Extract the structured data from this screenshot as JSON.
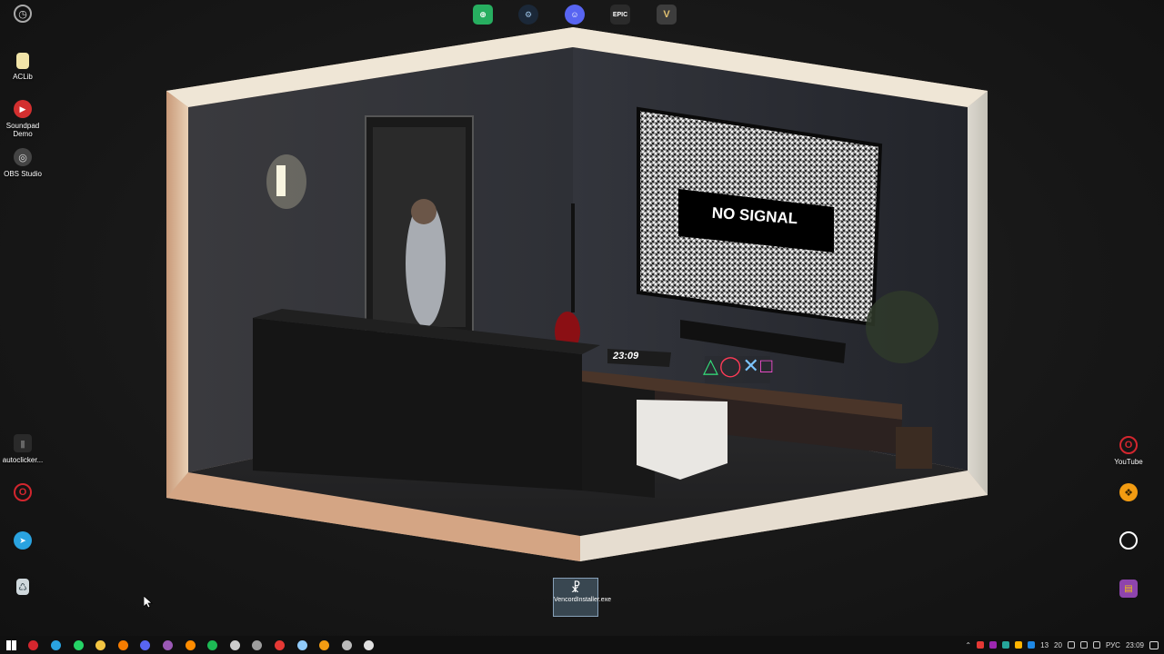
{
  "desktop": {
    "left_icons": [
      {
        "name": "clock-app-icon",
        "label": "",
        "color": "#9aa0a6",
        "glyph": "◷"
      },
      {
        "name": "aclib-icon",
        "label": "ACLib",
        "color": "#f1e4a8",
        "glyph": ""
      },
      {
        "name": "soundpad-icon",
        "label": "Soundpad Demo",
        "color": "#d32f2f",
        "glyph": "▶"
      },
      {
        "name": "obs-studio-icon",
        "label": "OBS Studio",
        "color": "#555555",
        "glyph": "◎"
      }
    ],
    "left_lower_icons": [
      {
        "name": "autoclicker-icon",
        "label": "autoclicker...",
        "color": "#333333",
        "glyph": "▮"
      },
      {
        "name": "opera-icon",
        "label": "",
        "color": "#d3262e",
        "glyph": "O"
      },
      {
        "name": "telegram-icon",
        "label": "",
        "color": "#2aa3e0",
        "glyph": "➤"
      },
      {
        "name": "recycle-bin-icon",
        "label": "",
        "color": "#b0bec5",
        "glyph": "♺"
      }
    ],
    "right_icons": [
      {
        "name": "youtube-opera-icon",
        "label": "YouTube",
        "color": "#d3262e",
        "glyph": "O"
      },
      {
        "name": "fl-studio-icon",
        "label": "",
        "color": "#f39c12",
        "glyph": "❖"
      },
      {
        "name": "chat-app-icon",
        "label": "",
        "color": "#ffffff",
        "glyph": "◯"
      },
      {
        "name": "winrar-icon",
        "label": "",
        "color": "#8e44ad",
        "glyph": "▤"
      }
    ],
    "top_icons": [
      {
        "name": "xbox-app-icon",
        "label": "",
        "color": "#27ae60",
        "glyph": "⊕"
      },
      {
        "name": "steam-icon",
        "label": "",
        "color": "#1b2838",
        "glyph": "⚙"
      },
      {
        "name": "discord-icon",
        "label": "",
        "color": "#5865f2",
        "glyph": "☺"
      },
      {
        "name": "epic-games-icon",
        "label": "EPIC",
        "color": "#2b2b2b",
        "glyph": ""
      },
      {
        "name": "gta-icon",
        "label": "V",
        "color": "#3d3d3d",
        "glyph": ""
      }
    ],
    "vencord": {
      "label": "VencordInstaller.exe",
      "glyph": "☧"
    },
    "wallpaper": {
      "tv_text": "NO SIGNAL",
      "clock_text": "23:09",
      "ps_symbols": [
        "△",
        "◯",
        "✕",
        "□"
      ]
    }
  },
  "taskbar": {
    "icons": [
      {
        "name": "start-button",
        "color": "#ffffff"
      },
      {
        "name": "opera-taskbar",
        "color": "#d3262e"
      },
      {
        "name": "telegram-taskbar",
        "color": "#2aa3e0"
      },
      {
        "name": "whatsapp-taskbar",
        "color": "#25d366"
      },
      {
        "name": "explorer-taskbar",
        "color": "#f4c542"
      },
      {
        "name": "chrome-like-taskbar",
        "color": "#f57c00"
      },
      {
        "name": "discord-taskbar",
        "color": "#5865f2"
      },
      {
        "name": "app-purple-taskbar",
        "color": "#9b59b6"
      },
      {
        "name": "search-orange-taskbar",
        "color": "#ff8c00"
      },
      {
        "name": "spotify-like-taskbar",
        "color": "#1db954"
      },
      {
        "name": "settings-taskbar",
        "color": "#cccccc"
      },
      {
        "name": "folder-taskbar",
        "color": "#9e9e9e"
      },
      {
        "name": "youtube-taskbar",
        "color": "#e53935"
      },
      {
        "name": "steam-taskbar",
        "color": "#90caf9"
      },
      {
        "name": "flstudio-taskbar",
        "color": "#f39c12"
      },
      {
        "name": "obs-taskbar",
        "color": "#bbbbbb"
      },
      {
        "name": "vencord-taskbar",
        "color": "#e0e0e0"
      }
    ],
    "tray": {
      "items": [
        "13",
        "20"
      ],
      "language": "РУС",
      "time": "23:09"
    }
  }
}
